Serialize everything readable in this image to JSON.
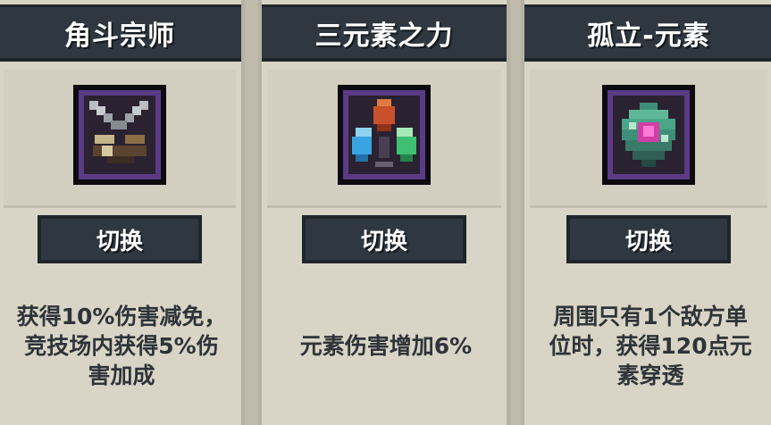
{
  "cards": [
    {
      "title": "角斗宗师",
      "icon": "crossed-swords-icon",
      "button_label": "切换",
      "description": "获得10%伤害减免，\n竞技场内获得5%伤\n害加成"
    },
    {
      "title": "三元素之力",
      "icon": "three-element-crystals-icon",
      "button_label": "切换",
      "description": "元素伤害增加6%"
    },
    {
      "title": "孤立-元素",
      "icon": "isolated-element-gem-icon",
      "button_label": "切换",
      "description": "周围只有1个敌方单\n位时，获得120点元\n素穿透"
    }
  ],
  "colors": {
    "panel_dark": "#2f3840",
    "card_bg": "#d9d5c6",
    "icon_border": "#5b3a86",
    "text": "#2e3439"
  }
}
